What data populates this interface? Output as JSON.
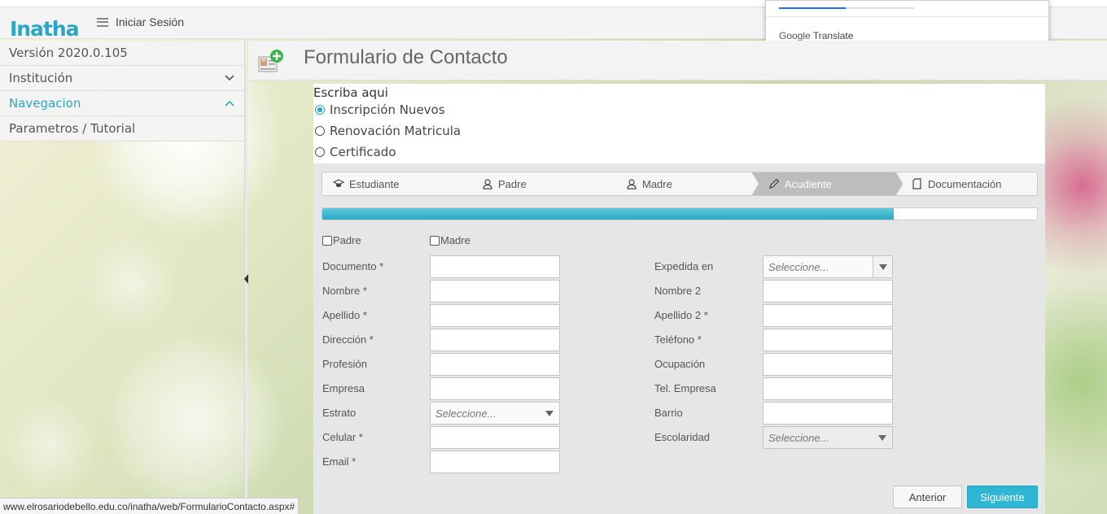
{
  "header": {
    "logo_text": "Inatha",
    "menu_label": "Iniciar Sesión"
  },
  "google_translate": {
    "brand_google": "Google",
    "brand_translate": "Translate"
  },
  "sidebar": {
    "items": [
      {
        "label": "Versión 2020.0.105"
      },
      {
        "label": "Institución",
        "icon": "chevron-down-icon"
      },
      {
        "label": "Navegacion",
        "icon": "chevron-up-icon"
      },
      {
        "label": "Parametros / Tutorial"
      }
    ]
  },
  "page": {
    "title": "Formulario de Contacto"
  },
  "options": {
    "title": "Escriba aqui",
    "radios": [
      {
        "label": "Inscripción Nuevos",
        "checked": true
      },
      {
        "label": "Renovación Matricula",
        "checked": false
      },
      {
        "label": "Certificado",
        "checked": false
      }
    ]
  },
  "wizard": {
    "steps": [
      {
        "label": "Estudiante",
        "icon": "graduation-cap-icon"
      },
      {
        "label": "Padre",
        "icon": "user-icon"
      },
      {
        "label": "Madre",
        "icon": "user-icon"
      },
      {
        "label": "Acudiente",
        "icon": "pencil-icon",
        "current": true
      },
      {
        "label": "Documentación",
        "icon": "document-icon"
      }
    ],
    "progress": 0.8
  },
  "form": {
    "checkboxes": [
      {
        "label": "Padre"
      },
      {
        "label": "Madre"
      }
    ],
    "left_labels": [
      "Documento *",
      "Nombre *",
      "Apellido *",
      "Dirección *",
      "Profesión",
      "Empresa",
      "Estrato",
      "Celular *",
      "Email *"
    ],
    "right_labels": [
      "Expedida en",
      "Nombre 2",
      "Apellido 2 *",
      "Teléfono *",
      "Ocupación",
      "Tel. Empresa",
      "Barrio",
      "Escolaridad"
    ],
    "select_placeholder": "Seleccione..."
  },
  "buttons": {
    "prev": "Anterior",
    "next": "Siguiente"
  },
  "status_bar": {
    "url": "www.elrosariodebello.edu.co/inatha/web/FormularioContacto.aspx#"
  },
  "colors": {
    "accent": "#2aa7c4",
    "button_primary": "#2fb6d5"
  }
}
